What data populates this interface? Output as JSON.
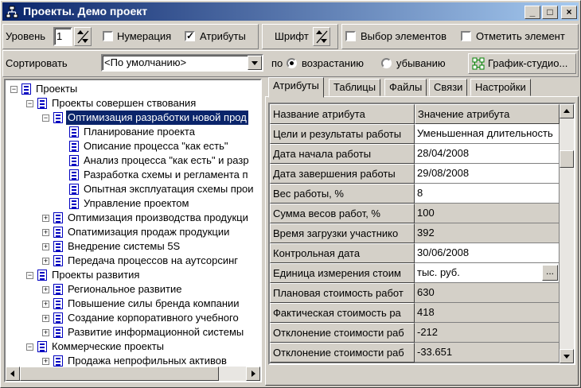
{
  "window": {
    "title": "Проекты. Демо проект",
    "buttons": {
      "minimize": "_",
      "maximize": "□",
      "close": "×"
    }
  },
  "toolbar": {
    "level_label": "Уровень",
    "level_value": "1",
    "numbering_label": "Нумерация",
    "numbering_checked": false,
    "attributes_label": "Атрибуты",
    "attributes_checked": true,
    "font_label": "Шрифт",
    "select_elements_label": "Выбор элементов",
    "select_elements_checked": false,
    "mark_element_label": "Отметить элемент",
    "mark_element_checked": false,
    "sort_label": "Сортировать",
    "sort_value": "<По умолчанию>",
    "order_label": "по",
    "ascending_label": "возрастанию",
    "descending_label": "убыванию",
    "ascending_selected": true,
    "gantt_button_label": "График-студио..."
  },
  "tree": {
    "items": [
      {
        "label": "Проекты",
        "level": 0,
        "expander": "−"
      },
      {
        "label": "Проекты совершен ствования",
        "level": 1,
        "expander": "−"
      },
      {
        "label": "Оптимизация разработки новой прод",
        "level": 2,
        "expander": "−",
        "selected": true
      },
      {
        "label": "Планирование проекта",
        "level": 3,
        "expander": ""
      },
      {
        "label": "Описание процесса \"как есть\"",
        "level": 3,
        "expander": ""
      },
      {
        "label": "Анализ процесса \"как есть\" и разр",
        "level": 3,
        "expander": ""
      },
      {
        "label": "Разработка схемы и регламента п",
        "level": 3,
        "expander": ""
      },
      {
        "label": "Опытная эксплуатация схемы прои",
        "level": 3,
        "expander": ""
      },
      {
        "label": "Управление проектом",
        "level": 3,
        "expander": ""
      },
      {
        "label": "Оптимизация производства продукци",
        "level": 2,
        "expander": "+"
      },
      {
        "label": "Опатимизация продаж продукции",
        "level": 2,
        "expander": "+"
      },
      {
        "label": "Внедрение системы 5S",
        "level": 2,
        "expander": "+"
      },
      {
        "label": "Передача процессов на аутсорсинг",
        "level": 2,
        "expander": "+"
      },
      {
        "label": "Проекты развития",
        "level": 1,
        "expander": "−"
      },
      {
        "label": "Региональное развитие",
        "level": 2,
        "expander": "+"
      },
      {
        "label": "Повышение силы бренда компании",
        "level": 2,
        "expander": "+"
      },
      {
        "label": "Создание корпоративного учебного",
        "level": 2,
        "expander": "+"
      },
      {
        "label": "Развитие информационной системы",
        "level": 2,
        "expander": "+"
      },
      {
        "label": "Коммерческие проекты",
        "level": 1,
        "expander": "−"
      },
      {
        "label": "Продажа непрофильных активов",
        "level": 2,
        "expander": "+"
      }
    ]
  },
  "tabs": [
    {
      "label": "Атрибуты",
      "active": true
    },
    {
      "label": "Таблицы",
      "active": false
    },
    {
      "label": "Файлы",
      "active": false
    },
    {
      "label": "Связи",
      "active": false
    },
    {
      "label": "Настройки",
      "active": false
    }
  ],
  "attributes": {
    "header": {
      "name": "Название атрибута",
      "value": "Значение атрибута"
    },
    "rows": [
      {
        "name": "Цели и результаты работы",
        "value": "Уменьшенная длительность",
        "editable": true
      },
      {
        "name": "Дата начала работы",
        "value": "28/04/2008",
        "editable": true
      },
      {
        "name": "Дата завершения работы",
        "value": "29/08/2008",
        "editable": true
      },
      {
        "name": "Вес работы, %",
        "value": "8",
        "editable": true
      },
      {
        "name": "Сумма весов работ, %",
        "value": "100",
        "editable": false
      },
      {
        "name": "Время загрузки участнико",
        "value": "392",
        "editable": false
      },
      {
        "name": "Контрольная дата",
        "value": "30/06/2008",
        "editable": true
      },
      {
        "name": "Единица измерения стоим",
        "value": "тыс. руб.",
        "editable": true,
        "button": "..."
      },
      {
        "name": "Плановая стоимость работ",
        "value": "630",
        "editable": false
      },
      {
        "name": "Фактическая стоимость ра",
        "value": "418",
        "editable": false
      },
      {
        "name": "Отклонение стоимости раб",
        "value": "-212",
        "editable": false
      },
      {
        "name": "Отклонение стоимости раб",
        "value": "-33.651",
        "editable": false
      }
    ]
  }
}
